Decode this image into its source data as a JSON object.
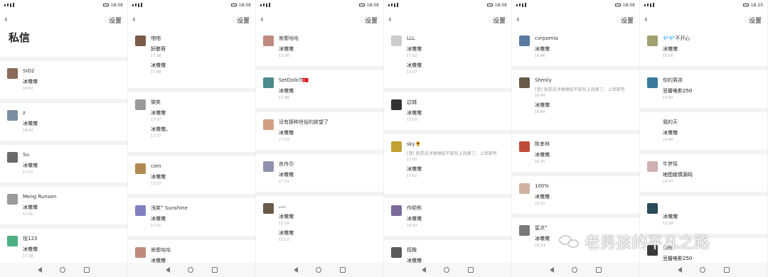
{
  "screens": [
    {
      "time": "18:09",
      "settings_label": "设置",
      "page_title": "私信",
      "rows": [
        {
          "name": "SiO2",
          "msg": "冰墩墩",
          "time": "18:02",
          "color": "#8a6a5a"
        },
        {
          "name": "z",
          "msg": "冰墩墩",
          "time": "18:00",
          "color": "#7a8ea0"
        },
        {
          "name": "Su",
          "msg": "冰墩墩",
          "time": "17:57",
          "color": "#6a6a6a"
        },
        {
          "name": "Meng Runsen",
          "msg": "冰墩墩",
          "time": "17:41",
          "color": "#9a9a9a"
        },
        {
          "name": "恒123",
          "msg": "冰墩墩",
          "time": "17:38",
          "color": "#4caf80"
        }
      ]
    },
    {
      "time": "18:09",
      "settings_label": "设置",
      "rows": [
        {
          "name": "咱咱",
          "msg": "好憨哥",
          "time": "17:38",
          "msg2": "冰墩墩",
          "time2": "17:08",
          "color": "#7a5a4a",
          "double": true
        },
        {
          "name": "微笑",
          "msg": "冰墩墩",
          "time": "17:37",
          "msg2": "冰墩墩。",
          "time2": "17:37",
          "color": "#9a9a9a",
          "double": true
        },
        {
          "name": "cien",
          "msg": "冰墩墩",
          "time": "17:23",
          "color": "#b08a50"
        },
        {
          "name": "浅笑° Sunshine",
          "msg": "冰墩墩",
          "time": "17:21",
          "color": "#8080c0"
        },
        {
          "name": "嵩壑咕咕",
          "msg": "冰墩墩",
          "time": "",
          "color": "#c08a80"
        }
      ]
    },
    {
      "time": "18:09",
      "settings_label": "设置",
      "rows": [
        {
          "name": "嵩壑咕咕",
          "msg": "冰墩墩",
          "time": "17:38",
          "color": "#c08a80"
        },
        {
          "name": "SetDolkiT🇹🇷",
          "msg": "冰墩墩",
          "time": "17:38",
          "color": "#4a8a8a"
        },
        {
          "name": "没有那种世俗的欲望了",
          "msg": "冰墩墩",
          "time": "17:24",
          "color": "#d0a080"
        },
        {
          "name": "良舟😊",
          "msg": "冰墩墩",
          "time": "17:23",
          "color": "#9090b0"
        },
        {
          "name": "。。。",
          "msg": "冰墩墩",
          "time": "17:14",
          "msg2": "冰墩墩",
          "time2": "17:13",
          "color": "#6a5a4a",
          "double": true
        }
      ]
    },
    {
      "time": "18:09",
      "settings_label": "设置",
      "rows": [
        {
          "name": "LLL",
          "msg": "冰墩墩",
          "time": "17:10",
          "msg2": "冰墩墩",
          "time2": "17:07",
          "color": "#cccccc",
          "double": true
        },
        {
          "name": "边城",
          "msg": "冰墩墩",
          "time": "17:03",
          "color": "#333333"
        },
        {
          "name": "sky🌻",
          "gray": "[我] 就是说冰墩墩能不能别上热搜了，上我家吧",
          "msg": "冰墩墩",
          "time": "17:02",
          "time0": "17:03",
          "color": "#c0a030",
          "tall": true
        },
        {
          "name": "作顿熊",
          "msg": "冰墩墩",
          "time": "16:54",
          "color": "#7a6a9a"
        },
        {
          "name": "桓楷",
          "msg": "冰墩墩",
          "time": "",
          "color": "#5a5a5a"
        }
      ]
    },
    {
      "time": "18:09",
      "settings_label": "设置",
      "rows": [
        {
          "name": "cvrpomia",
          "msg": "冰墩墩",
          "time": "16:46",
          "color": "#5a7aa0"
        },
        {
          "name": "Shmily",
          "gray": "[我] 就是说冰墩墩能不能别上热搜了，上我家吧",
          "msg": "冰墩墩",
          "time": "16:44",
          "time0": "16:44",
          "color": "#6a5a4a",
          "tall": true
        },
        {
          "name": "陈孝林",
          "msg": "冰墩墩",
          "time": "16:25",
          "color": "#c04a3a"
        },
        {
          "name": "100%",
          "msg": "冰墩墩",
          "time": "16:15",
          "color": "#d0b0a0"
        },
        {
          "name": "星点°",
          "msg": "冰墩墩",
          "time": "16:14",
          "color": "#7a7a7a"
        }
      ]
    },
    {
      "time": "18:10",
      "settings_label": "设置",
      "rows": [
        {
          "name": "💎💎不开心",
          "msg": "冰墩墩",
          "time": "15:56",
          "color": "#a0a070"
        },
        {
          "name": "你的男孩",
          "msg": "豆瓣电影250",
          "time": "14:50",
          "color": "#3a7a9a"
        },
        {
          "name": "我的天",
          "msg": "冰墩墩",
          "time": "14:48",
          "color": "#ffffff"
        },
        {
          "name": "牛梦瑶",
          "msg": "地图疫情源码",
          "time": "14:47",
          "color": "#d0b0b0"
        },
        {
          "name": "",
          "msg": "冰墩墩",
          "time": "13:58",
          "color": "#2a4a5a"
        },
        {
          "name": "汤秋",
          "msg": "豆瓣电影250",
          "time": "",
          "color": "#3a3a3a"
        }
      ]
    }
  ],
  "watermark": "老男孩的平凡之路"
}
